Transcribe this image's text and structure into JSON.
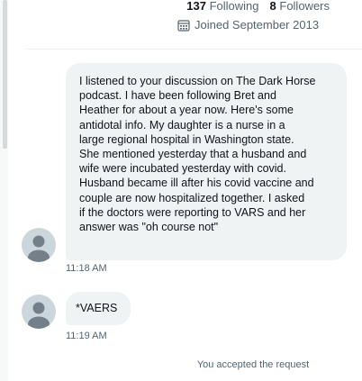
{
  "profile": {
    "following_count": "137",
    "following_label": "Following",
    "followers_count": "8",
    "followers_label": "Followers",
    "joined_text": "Joined September 2013",
    "joined_icon": "calendar-icon"
  },
  "messages": [
    {
      "lines": [
        "I listened to your discussion on The Dark Horse",
        "podcast.  I have been following Bret and",
        "Heather for about a year now.  Here's some",
        "antidotal info.  My daughter is a nurse in a",
        "large regional hospital in Washington state.",
        "She mentioned yesterday that a husband and",
        "wife were incubated yesterday with covid.",
        "Husband became ill after his covid vaccine and",
        "couple are now hospitalized together.  I asked",
        "if the doctors were reporting to VARS and her",
        "answer was \"oh course not\""
      ],
      "time": "11:18 AM"
    },
    {
      "lines": [
        "*VAERS"
      ],
      "time": "11:19 AM"
    }
  ],
  "system_note": "You accepted the request",
  "colors": {
    "bubble": "#eff3f4",
    "secondary_text": "#536471",
    "avatar_bg": "#ccd6dd",
    "avatar_fg": "#73808a"
  }
}
